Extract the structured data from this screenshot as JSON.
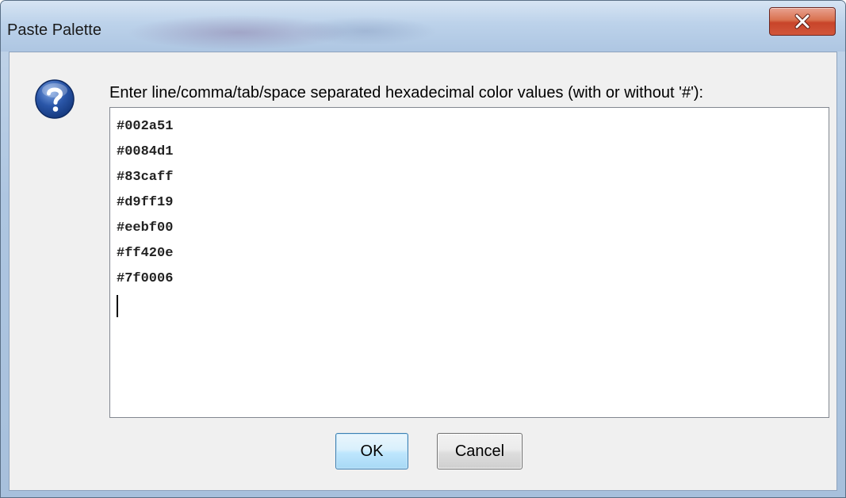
{
  "window": {
    "title": "Paste Palette",
    "close_glyph": "x"
  },
  "dialog": {
    "icon": "help-question-icon",
    "prompt": "Enter line/comma/tab/space separated hexadecimal color values (with or without '#'):",
    "colors_text": [
      "#002a51",
      "#0084d1",
      "#83caff",
      "#d9ff19",
      "#eebf00",
      "#ff420e",
      "#7f0006"
    ]
  },
  "buttons": {
    "ok": "OK",
    "cancel": "Cancel"
  },
  "theme": {
    "help_icon_color": "#2a56a8",
    "close_button_color": "#c8442a",
    "ok_button_border": "#3c7fb1"
  }
}
